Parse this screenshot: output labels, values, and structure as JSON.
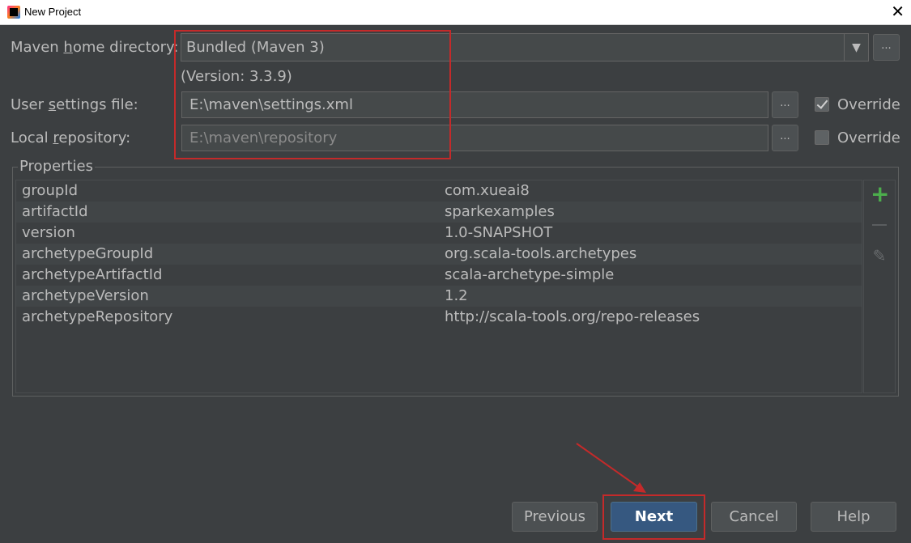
{
  "window": {
    "title": "New Project"
  },
  "maven_home": {
    "label_pre": "Maven ",
    "label_mnemonic": "h",
    "label_post": "ome directory:",
    "value": "Bundled (Maven 3)",
    "version": "(Version: 3.3.9)"
  },
  "user_settings": {
    "label_pre": "User ",
    "label_mnemonic": "s",
    "label_post": "ettings file:",
    "value": "E:\\maven\\settings.xml",
    "override_label": "Override",
    "override_checked": true
  },
  "local_repo": {
    "label_pre": "Local ",
    "label_mnemonic": "r",
    "label_post": "epository:",
    "value": "E:\\maven\\repository",
    "override_label": "Override",
    "override_checked": false
  },
  "browse_label": "...",
  "properties": {
    "title": "Properties",
    "rows": [
      {
        "key": "groupId",
        "value": "com.xueai8"
      },
      {
        "key": "artifactId",
        "value": "sparkexamples"
      },
      {
        "key": "version",
        "value": "1.0-SNAPSHOT"
      },
      {
        "key": "archetypeGroupId",
        "value": "org.scala-tools.archetypes"
      },
      {
        "key": "archetypeArtifactId",
        "value": "scala-archetype-simple"
      },
      {
        "key": "archetypeVersion",
        "value": "1.2"
      },
      {
        "key": "archetypeRepository",
        "value": "http://scala-tools.org/repo-releases"
      }
    ]
  },
  "buttons": {
    "previous": "Previous",
    "next": "Next",
    "cancel": "Cancel",
    "help": "Help"
  },
  "colors": {
    "annotation": "#c42a2a",
    "add_icon": "#4cae4c"
  }
}
